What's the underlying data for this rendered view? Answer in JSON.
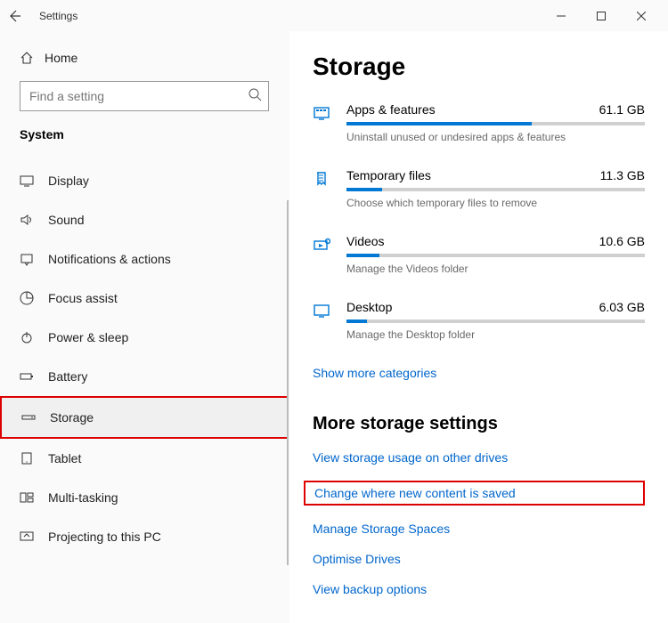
{
  "window": {
    "title": "Settings"
  },
  "sidebar": {
    "home": "Home",
    "searchPlaceholder": "Find a setting",
    "section": "System",
    "items": [
      {
        "label": "Display"
      },
      {
        "label": "Sound"
      },
      {
        "label": "Notifications & actions"
      },
      {
        "label": "Focus assist"
      },
      {
        "label": "Power & sleep"
      },
      {
        "label": "Battery"
      },
      {
        "label": "Storage"
      },
      {
        "label": "Tablet"
      },
      {
        "label": "Multi-tasking"
      },
      {
        "label": "Projecting to this PC"
      }
    ]
  },
  "main": {
    "title": "Storage",
    "categories": [
      {
        "name": "Apps & features",
        "size": "61.1 GB",
        "desc": "Uninstall unused or undesired apps & features",
        "pct": 62
      },
      {
        "name": "Temporary files",
        "size": "11.3 GB",
        "desc": "Choose which temporary files to remove",
        "pct": 12
      },
      {
        "name": "Videos",
        "size": "10.6 GB",
        "desc": "Manage the Videos folder",
        "pct": 11
      },
      {
        "name": "Desktop",
        "size": "6.03 GB",
        "desc": "Manage the Desktop folder",
        "pct": 7
      }
    ],
    "showMore": "Show more categories",
    "moreTitle": "More storage settings",
    "links": [
      "View storage usage on other drives",
      "Change where new content is saved",
      "Manage Storage Spaces",
      "Optimise Drives",
      "View backup options"
    ]
  }
}
